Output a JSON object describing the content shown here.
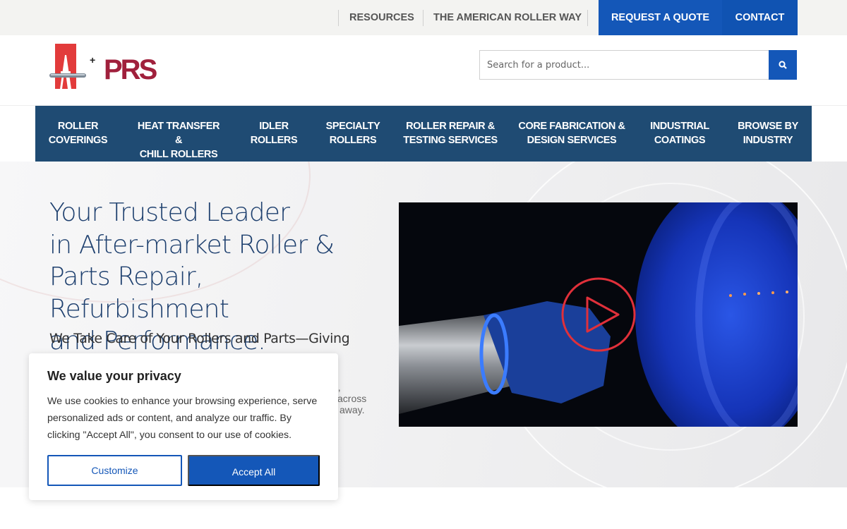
{
  "topbar": {
    "links": [
      "RESOURCES",
      "THE AMERICAN ROLLER WAY"
    ],
    "quote_label": "REQUEST A QUOTE",
    "contact_label": "CONTACT"
  },
  "header": {
    "logo_text": "A+PRS",
    "search_placeholder": "Search for a product..."
  },
  "nav": {
    "items": [
      "ROLLER\nCOVERINGS",
      "HEAT TRANSFER &\nCHILL ROLLERS",
      "IDLER\nROLLERS",
      "SPECIALTY\nROLLERS",
      "ROLLER REPAIR &\nTESTING SERVICES",
      "CORE FABRICATION &\nDESIGN SERVICES",
      "INDUSTRIAL\nCOATINGS",
      "BROWSE BY\nINDUSTRY"
    ]
  },
  "hero": {
    "title": "Your Trusted Leader\nin After-market Roller &\nParts Repair, Refurbishment\nand Performance.",
    "subtitle": "We Take Care of Your Rollers and Parts—Giving",
    "body_fragment_1": "g,",
    "body_fragment_2": "across",
    "body_fragment_3": "away."
  },
  "cookie": {
    "title": "We value your privacy",
    "text": "We use cookies to enhance your browsing experience, serve personalized ads or content, and analyze our traffic. By clicking \"Accept All\", you consent to our use of cookies.",
    "customize_label": "Customize",
    "accept_label": "Accept All"
  },
  "colors": {
    "brand_blue": "#1457b8",
    "nav_navy": "#1f4b73",
    "logo_red": "#e23b3b",
    "logo_maroon": "#a0203c"
  }
}
